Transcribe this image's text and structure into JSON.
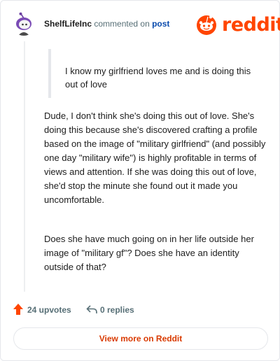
{
  "header": {
    "username": "ShelfLifeInc",
    "verb": "commented on",
    "post_link": "post",
    "logo_text": "reddit"
  },
  "comment": {
    "quote": "I know my girlfriend loves me and is doing this out of love",
    "paragraphs": [
      "Dude, I don't think she's doing this out of love. She's doing this because she's discovered crafting a profile based on the image of \"military girlfriend\" (and possibly one day \"military wife\") is highly profitable in terms of views and attention. If she was doing this out of love, she'd stop the minute she found out it made you uncomfortable.",
      "Does she have much going on in her life outside her image of \"military gf\"? Does she have an identity outside of that?"
    ]
  },
  "actions": {
    "upvotes": "24 upvotes",
    "replies": "0 replies"
  },
  "view_more_label": "View more on Reddit",
  "colors": {
    "brand": "#ff4500",
    "upvote": "#ff4500",
    "link": "#0a4bad",
    "muted": "#576f76",
    "button_text": "#d93a00"
  },
  "icons": {
    "avatar": "snoo-avatar-icon",
    "logo": "reddit-snoo-icon",
    "upvote": "upvote-arrow-icon",
    "reply": "reply-arrow-icon"
  }
}
